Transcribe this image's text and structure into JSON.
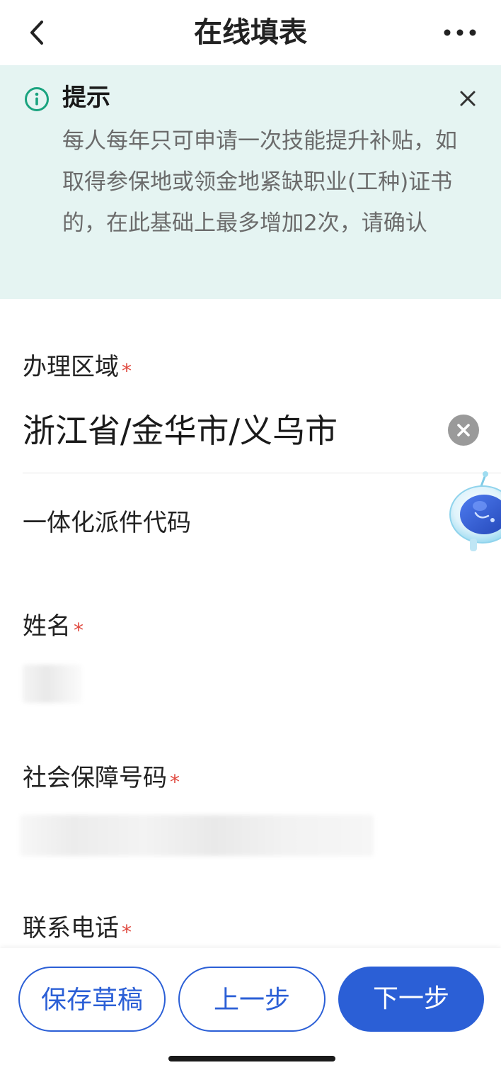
{
  "header": {
    "title": "在线填表",
    "back_icon": "chevron-left-icon",
    "more_icon": "more-dots-icon"
  },
  "notice": {
    "title": "提示",
    "body": "每人每年只可申请一次技能提升补贴，如取得参保地或领金地紧缺职业(工种)证书的，在此基础上最多增加2次，请确认",
    "info_icon": "info-circle-icon",
    "close_icon": "close-icon"
  },
  "form": {
    "region": {
      "label": "办理区域",
      "required_mark": "*",
      "value": "浙江省/金华市/义乌市",
      "clear_icon": "clear-circle-icon"
    },
    "dispatch_code": {
      "label": "一体化派件代码"
    },
    "name": {
      "label": "姓名",
      "required_mark": "*"
    },
    "ssn": {
      "label": "社会保障号码",
      "required_mark": "*"
    },
    "phone": {
      "label": "联系电话",
      "required_mark": "*"
    }
  },
  "actions": {
    "save_draft": "保存草稿",
    "previous": "上一步",
    "next": "下一步"
  },
  "colors": {
    "primary": "#2b5fd6",
    "notice_bg": "#e5f4f2",
    "info_icon": "#1aa37f",
    "required": "#e0483e"
  }
}
